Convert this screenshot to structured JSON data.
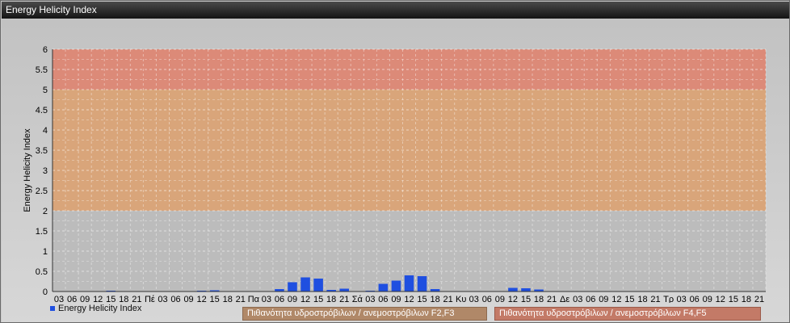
{
  "window": {
    "title": "Energy Helicity Index"
  },
  "legend": {
    "series_label": "Energy Helicity Index",
    "band_low_label": "Πιθανότητα υδροστρόβιλων / ανεμοστρόβιλων F2,F3",
    "band_high_label": "Πιθανότητα υδροστρόβιλων / ανεμοστρόβιλων F4,F5"
  },
  "colors": {
    "bar": "#1f4fe0",
    "band_low": "#d9a57a",
    "band_high": "#dc8a78",
    "plot_bg": "#bcbcbc"
  },
  "chart_data": {
    "type": "bar",
    "title": "",
    "xlabel": "",
    "ylabel": "Energy Helicity Index",
    "ylim": [
      0,
      6
    ],
    "y_ticks": [
      "0",
      "0.5",
      "1",
      "1.5",
      "2",
      "2.5",
      "3",
      "3.5",
      "4",
      "4.5",
      "5",
      "5.5",
      "6"
    ],
    "grid": true,
    "bands": [
      {
        "from": 2,
        "to": 5,
        "label": "Πιθανότητα υδροστρόβιλων / ανεμοστρόβιλων F2,F3"
      },
      {
        "from": 5,
        "to": 6,
        "label": "Πιθανότητα υδροστρόβιλων / ανεμοστρόβιλων F4,F5"
      }
    ],
    "categories": [
      "03",
      "06",
      "09",
      "12",
      "15",
      "18",
      "21",
      "Πέ",
      "03",
      "06",
      "09",
      "12",
      "15",
      "18",
      "21",
      "Πα",
      "03",
      "06",
      "09",
      "12",
      "15",
      "18",
      "21",
      "Σά",
      "03",
      "06",
      "09",
      "12",
      "15",
      "18",
      "21",
      "Κυ",
      "03",
      "06",
      "09",
      "12",
      "15",
      "18",
      "21",
      "Δε",
      "03",
      "06",
      "09",
      "12",
      "15",
      "18",
      "21",
      "Τρ",
      "03",
      "06",
      "09",
      "12",
      "15",
      "18",
      "21"
    ],
    "series": [
      {
        "name": "Energy Helicity Index",
        "values": [
          0.01,
          0.01,
          0.01,
          0.01,
          0.02,
          0.01,
          0.01,
          0.01,
          0.01,
          0.01,
          0.01,
          0.02,
          0.03,
          0.01,
          0.01,
          0.01,
          0.01,
          0.06,
          0.23,
          0.35,
          0.32,
          0.04,
          0.07,
          0.01,
          0.02,
          0.19,
          0.27,
          0.4,
          0.38,
          0.06,
          0.01,
          0.01,
          0.01,
          0.01,
          0.01,
          0.09,
          0.08,
          0.05,
          0.01,
          0.01,
          0.01,
          0.01,
          0.01,
          0.01,
          0.01,
          0.01,
          0.01,
          0.01,
          0.01,
          0.01,
          0.01,
          0.01,
          0.01,
          0.01,
          0.01
        ]
      }
    ],
    "legend_position": "bottom-left"
  }
}
